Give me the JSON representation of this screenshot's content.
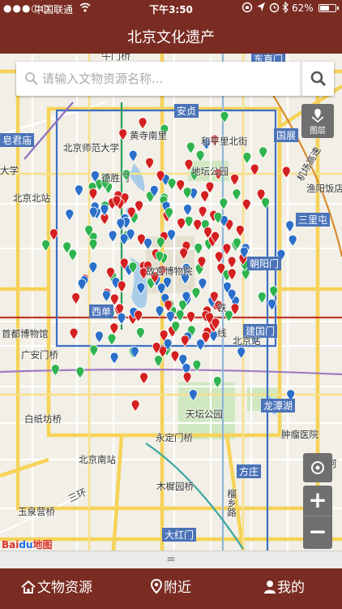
{
  "status_bar": {
    "signal": "●●●○○",
    "carrier": "中国联通",
    "time": "下午3:50",
    "battery": "62%",
    "battery_level": 0.62,
    "icons": [
      "wifi-icon",
      "lock-rotation-icon",
      "location-icon",
      "alarm-icon",
      "bluetooth-icon",
      "battery-icon"
    ]
  },
  "header": {
    "title": "北京文化遗产"
  },
  "search": {
    "placeholder": "请输入文物资源名称..."
  },
  "map": {
    "layer_button_label": "图层",
    "labels": {
      "lbl_1": "牛门桥",
      "lbl_2": "东直门",
      "lbl_3": "安贞",
      "lbl_4": "黄寺南里",
      "lbl_5": "和平里北街",
      "lbl_6": "国展",
      "lbl_7": "皂君庙",
      "lbl_8": "北京师范大学",
      "lbl_9": "机场高速",
      "lbl_10": "大学",
      "lbl_11": "德胜门",
      "lbl_12": "地坛公园",
      "lbl_13": "渔阳饭店",
      "lbl_14": "北京北站",
      "lbl_15": "三里屯",
      "lbl_16": "朝阳门",
      "lbl_17": "故宫博物院",
      "lbl_18": "西单",
      "lbl_19": "建国门",
      "lbl_20": "首都博物馆",
      "lbl_21": "北京站",
      "lbl_22": "广安门桥",
      "lbl_23": "天坛公园",
      "lbl_24": "龙潭湖",
      "lbl_25": "白纸坊桥",
      "lbl_26": "肿瘤医院",
      "lbl_27": "永定门桥",
      "lbl_28": "北京南站",
      "lbl_29": "方庄",
      "lbl_30": "三环",
      "lbl_31": "木樨园桥",
      "lbl_32": "榴乡路",
      "lbl_33": "玉泉营桥",
      "lbl_34": "大红门",
      "lbl_35": "铁",
      "lbl_36": "线",
      "lbl_37": "河"
    },
    "attribution": {
      "bai": "Bai",
      "du": "du",
      "map": "地图"
    },
    "marker_colors": {
      "red": "#d42020",
      "green": "#2fb34e",
      "blue": "#2a6fc9"
    }
  },
  "handle": {
    "label": "="
  },
  "tabs": [
    {
      "label": "文物资源",
      "icon": "home-icon"
    },
    {
      "label": "附近",
      "icon": "location-pin-icon"
    },
    {
      "label": "我的",
      "icon": "user-icon"
    }
  ]
}
